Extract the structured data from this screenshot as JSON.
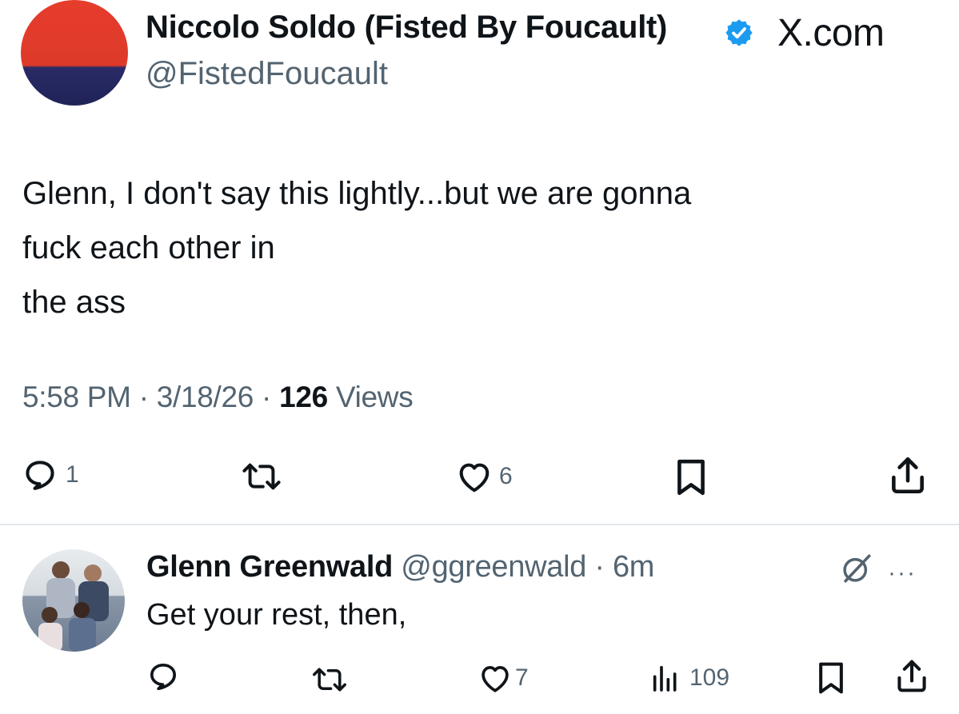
{
  "tweet": {
    "author_name": "Niccolo Soldo (Fisted By Foucault)",
    "handle": "@FistedFoucault",
    "brand": "X.com",
    "text_lines": [
      "Glenn, I don't say this lightly...but we are gonna",
      "fuck each other in",
      "the ass"
    ],
    "time": "5:58 PM",
    "date": "3/18/26",
    "separator": "·",
    "views_count": "126",
    "views_label": "Views",
    "actions": {
      "replies": "1",
      "likes": "6"
    },
    "colors": {
      "verified": "#1d9bf0",
      "avatar_top": "#e63c2c",
      "avatar_bottom": "#22265a"
    }
  },
  "reply": {
    "author_name": "Glenn Greenwald",
    "handle": "@ggreenwald",
    "separator": "·",
    "age": "6m",
    "text": "Get your rest, then,",
    "more": "···",
    "actions": {
      "likes": "7",
      "views": "109"
    }
  },
  "icons": [
    "reply-icon",
    "retweet-icon",
    "like-icon",
    "bookmark-icon",
    "share-icon",
    "verified-badge-icon",
    "grok-icon",
    "more-icon",
    "views-icon"
  ]
}
